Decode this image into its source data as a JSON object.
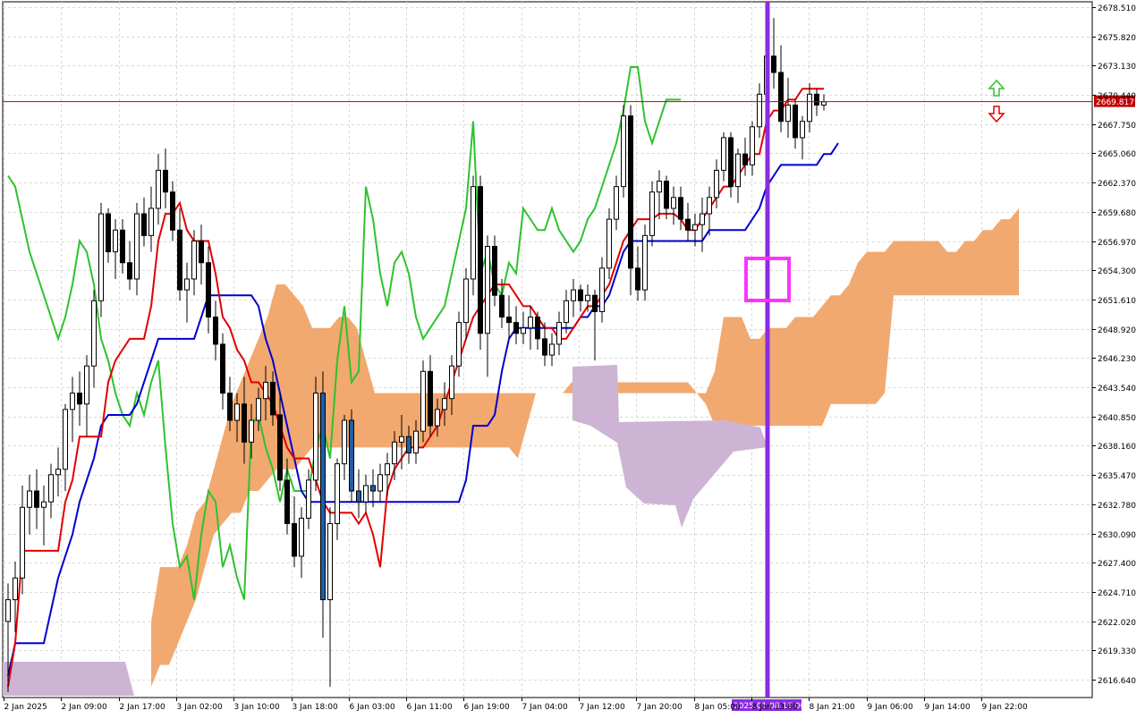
{
  "chart_data": {
    "type": "candlestick",
    "y_axis": {
      "ticks": [
        "2678.510",
        "2675.820",
        "2673.130",
        "2670.440",
        "2667.750",
        "2665.060",
        "2662.370",
        "2659.680",
        "2656.970",
        "2654.300",
        "2651.610",
        "2648.920",
        "2646.230",
        "2643.540",
        "2640.850",
        "2638.160",
        "2635.470",
        "2632.780",
        "2630.090",
        "2627.400",
        "2624.710",
        "2622.020",
        "2619.330",
        "2616.640"
      ],
      "range": [
        2615.0,
        2679.0
      ]
    },
    "x_axis": {
      "ticks": [
        "2 Jan 2025",
        "2 Jan 09:00",
        "2 Jan 17:00",
        "3 Jan 02:00",
        "3 Jan 10:00",
        "3 Jan 18:00",
        "6 Jan 03:00",
        "6 Jan 11:00",
        "6 Jan 19:00",
        "7 Jan 04:00",
        "7 Jan 12:00",
        "7 Jan 20:00",
        "8 Jan 05:00",
        "8 Jan 13:00",
        "8 Jan 21:00",
        "9 Jan 06:00",
        "9 Jan 14:00",
        "9 Jan 22:00"
      ],
      "highlight_label": "2025.01.08 16:00"
    },
    "current_price": "2669.817",
    "grid": true,
    "colors": {
      "tenkan": "#e00000",
      "kijun": "#0000d0",
      "chikou": "#2ec22e",
      "kumo_bull": "#f0a060",
      "kumo_bear": "#cdb4d4",
      "price_line": "#c00000",
      "vertical_marker": "#8b2be2",
      "highlight_box": "#ff33ff",
      "arrow_up": "#2ec22e",
      "arrow_down": "#e00000"
    },
    "candles": [
      {
        "o": 2622.0,
        "h": 2625.5,
        "l": 2615.5,
        "c": 2624.0
      },
      {
        "o": 2624.0,
        "h": 2627.5,
        "l": 2621.0,
        "c": 2626.0
      },
      {
        "o": 2626.0,
        "h": 2634.5,
        "l": 2624.5,
        "c": 2632.5
      },
      {
        "o": 2632.5,
        "h": 2635.5,
        "l": 2630.0,
        "c": 2634.0
      },
      {
        "o": 2634.0,
        "h": 2636.0,
        "l": 2630.5,
        "c": 2632.5
      },
      {
        "o": 2632.5,
        "h": 2634.5,
        "l": 2629.0,
        "c": 2633.0
      },
      {
        "o": 2633.0,
        "h": 2636.5,
        "l": 2631.5,
        "c": 2635.5
      },
      {
        "o": 2635.5,
        "h": 2638.0,
        "l": 2633.5,
        "c": 2636.0
      },
      {
        "o": 2636.0,
        "h": 2642.0,
        "l": 2634.0,
        "c": 2641.5
      },
      {
        "o": 2641.5,
        "h": 2644.5,
        "l": 2638.5,
        "c": 2643.0
      },
      {
        "o": 2643.0,
        "h": 2645.0,
        "l": 2640.0,
        "c": 2642.0
      },
      {
        "o": 2642.0,
        "h": 2646.5,
        "l": 2639.0,
        "c": 2645.5
      },
      {
        "o": 2645.5,
        "h": 2652.5,
        "l": 2643.5,
        "c": 2651.5
      },
      {
        "o": 2651.5,
        "h": 2660.5,
        "l": 2650.0,
        "c": 2659.5
      },
      {
        "o": 2659.5,
        "h": 2660.0,
        "l": 2655.0,
        "c": 2656.0
      },
      {
        "o": 2656.0,
        "h": 2659.0,
        "l": 2653.5,
        "c": 2658.0
      },
      {
        "o": 2658.0,
        "h": 2659.0,
        "l": 2654.0,
        "c": 2655.0
      },
      {
        "o": 2655.0,
        "h": 2657.0,
        "l": 2652.5,
        "c": 2653.5
      },
      {
        "o": 2653.5,
        "h": 2660.5,
        "l": 2652.0,
        "c": 2659.5
      },
      {
        "o": 2659.5,
        "h": 2661.0,
        "l": 2656.5,
        "c": 2657.5
      },
      {
        "o": 2657.5,
        "h": 2662.0,
        "l": 2656.0,
        "c": 2660.0
      },
      {
        "o": 2660.0,
        "h": 2665.0,
        "l": 2658.5,
        "c": 2663.5
      },
      {
        "o": 2663.5,
        "h": 2665.5,
        "l": 2660.0,
        "c": 2661.5
      },
      {
        "o": 2661.5,
        "h": 2662.5,
        "l": 2657.0,
        "c": 2658.0
      },
      {
        "o": 2658.0,
        "h": 2660.0,
        "l": 2651.5,
        "c": 2652.5
      },
      {
        "o": 2652.5,
        "h": 2655.0,
        "l": 2649.5,
        "c": 2653.5
      },
      {
        "o": 2653.5,
        "h": 2658.0,
        "l": 2652.0,
        "c": 2657.0
      },
      {
        "o": 2657.0,
        "h": 2658.5,
        "l": 2653.0,
        "c": 2655.0
      },
      {
        "o": 2655.0,
        "h": 2656.5,
        "l": 2648.5,
        "c": 2650.0
      },
      {
        "o": 2650.0,
        "h": 2651.5,
        "l": 2646.0,
        "c": 2647.5
      },
      {
        "o": 2647.5,
        "h": 2648.5,
        "l": 2641.5,
        "c": 2643.0
      },
      {
        "o": 2643.0,
        "h": 2644.5,
        "l": 2639.5,
        "c": 2640.5
      },
      {
        "o": 2640.5,
        "h": 2643.0,
        "l": 2638.5,
        "c": 2642.0
      },
      {
        "o": 2642.0,
        "h": 2644.5,
        "l": 2636.5,
        "c": 2638.5
      },
      {
        "o": 2638.5,
        "h": 2642.0,
        "l": 2637.0,
        "c": 2640.5
      },
      {
        "o": 2640.5,
        "h": 2643.5,
        "l": 2639.5,
        "c": 2642.5
      },
      {
        "o": 2642.5,
        "h": 2645.5,
        "l": 2640.5,
        "c": 2644.0
      },
      {
        "o": 2644.0,
        "h": 2645.0,
        "l": 2640.0,
        "c": 2641.0
      },
      {
        "o": 2641.0,
        "h": 2643.0,
        "l": 2634.0,
        "c": 2635.0
      },
      {
        "o": 2635.0,
        "h": 2637.0,
        "l": 2630.0,
        "c": 2631.0
      },
      {
        "o": 2631.0,
        "h": 2633.5,
        "l": 2627.0,
        "c": 2628.0
      },
      {
        "o": 2628.0,
        "h": 2632.5,
        "l": 2626.0,
        "c": 2631.5
      },
      {
        "o": 2631.5,
        "h": 2636.0,
        "l": 2630.5,
        "c": 2635.0
      },
      {
        "o": 2635.0,
        "h": 2644.5,
        "l": 2634.0,
        "c": 2643.0
      },
      {
        "o": 2643.0,
        "h": 2645.0,
        "l": 2620.5,
        "c": 2624.0
      },
      {
        "o": 2624.0,
        "h": 2632.5,
        "l": 2616.0,
        "c": 2631.0
      },
      {
        "o": 2631.0,
        "h": 2637.0,
        "l": 2629.5,
        "c": 2636.5
      },
      {
        "o": 2636.5,
        "h": 2641.0,
        "l": 2635.0,
        "c": 2640.5
      },
      {
        "o": 2640.5,
        "h": 2641.5,
        "l": 2633.0,
        "c": 2634.0
      },
      {
        "o": 2634.0,
        "h": 2636.0,
        "l": 2631.5,
        "c": 2633.0
      },
      {
        "o": 2633.0,
        "h": 2635.5,
        "l": 2632.0,
        "c": 2634.5
      },
      {
        "o": 2634.5,
        "h": 2636.0,
        "l": 2632.5,
        "c": 2634.0
      },
      {
        "o": 2634.0,
        "h": 2636.5,
        "l": 2633.0,
        "c": 2635.5
      },
      {
        "o": 2635.5,
        "h": 2637.5,
        "l": 2633.5,
        "c": 2636.5
      },
      {
        "o": 2636.5,
        "h": 2639.5,
        "l": 2635.0,
        "c": 2638.5
      },
      {
        "o": 2638.5,
        "h": 2641.0,
        "l": 2636.0,
        "c": 2639.0
      },
      {
        "o": 2639.0,
        "h": 2640.0,
        "l": 2636.5,
        "c": 2637.5
      },
      {
        "o": 2637.5,
        "h": 2640.5,
        "l": 2636.5,
        "c": 2639.5
      },
      {
        "o": 2639.5,
        "h": 2646.0,
        "l": 2638.5,
        "c": 2645.0
      },
      {
        "o": 2645.0,
        "h": 2646.5,
        "l": 2639.0,
        "c": 2640.0
      },
      {
        "o": 2640.0,
        "h": 2642.5,
        "l": 2639.0,
        "c": 2641.5
      },
      {
        "o": 2641.5,
        "h": 2644.0,
        "l": 2640.0,
        "c": 2642.5
      },
      {
        "o": 2642.5,
        "h": 2646.5,
        "l": 2641.0,
        "c": 2645.5
      },
      {
        "o": 2645.5,
        "h": 2650.5,
        "l": 2644.5,
        "c": 2649.5
      },
      {
        "o": 2649.5,
        "h": 2654.5,
        "l": 2648.0,
        "c": 2653.5
      },
      {
        "o": 2653.5,
        "h": 2663.0,
        "l": 2652.0,
        "c": 2662.0
      },
      {
        "o": 2662.0,
        "h": 2663.0,
        "l": 2647.0,
        "c": 2648.5
      },
      {
        "o": 2648.5,
        "h": 2657.5,
        "l": 2644.5,
        "c": 2656.5
      },
      {
        "o": 2656.5,
        "h": 2657.5,
        "l": 2651.0,
        "c": 2652.0
      },
      {
        "o": 2652.0,
        "h": 2653.5,
        "l": 2649.0,
        "c": 2650.0
      },
      {
        "o": 2650.0,
        "h": 2652.0,
        "l": 2648.0,
        "c": 2649.5
      },
      {
        "o": 2649.5,
        "h": 2651.0,
        "l": 2647.5,
        "c": 2648.5
      },
      {
        "o": 2648.5,
        "h": 2650.5,
        "l": 2647.5,
        "c": 2649.0
      },
      {
        "o": 2649.0,
        "h": 2651.0,
        "l": 2647.0,
        "c": 2650.0
      },
      {
        "o": 2650.0,
        "h": 2650.5,
        "l": 2647.0,
        "c": 2648.0
      },
      {
        "o": 2648.0,
        "h": 2649.5,
        "l": 2645.5,
        "c": 2646.5
      },
      {
        "o": 2646.5,
        "h": 2648.5,
        "l": 2645.5,
        "c": 2647.5
      },
      {
        "o": 2647.5,
        "h": 2650.5,
        "l": 2646.5,
        "c": 2649.5
      },
      {
        "o": 2649.5,
        "h": 2652.5,
        "l": 2648.5,
        "c": 2651.5
      },
      {
        "o": 2651.5,
        "h": 2653.5,
        "l": 2650.0,
        "c": 2652.5
      },
      {
        "o": 2652.5,
        "h": 2653.0,
        "l": 2650.5,
        "c": 2651.5
      },
      {
        "o": 2651.5,
        "h": 2653.0,
        "l": 2650.5,
        "c": 2652.0
      },
      {
        "o": 2652.0,
        "h": 2652.5,
        "l": 2646.0,
        "c": 2650.5
      },
      {
        "o": 2650.5,
        "h": 2655.5,
        "l": 2649.5,
        "c": 2654.5
      },
      {
        "o": 2654.5,
        "h": 2660.0,
        "l": 2653.5,
        "c": 2659.0
      },
      {
        "o": 2659.0,
        "h": 2663.0,
        "l": 2658.0,
        "c": 2662.0
      },
      {
        "o": 2662.0,
        "h": 2669.5,
        "l": 2661.0,
        "c": 2668.5
      },
      {
        "o": 2668.5,
        "h": 2669.5,
        "l": 2652.0,
        "c": 2654.5
      },
      {
        "o": 2654.5,
        "h": 2656.5,
        "l": 2651.5,
        "c": 2652.5
      },
      {
        "o": 2652.5,
        "h": 2658.5,
        "l": 2651.5,
        "c": 2657.5
      },
      {
        "o": 2657.5,
        "h": 2662.5,
        "l": 2656.5,
        "c": 2661.5
      },
      {
        "o": 2661.5,
        "h": 2663.5,
        "l": 2659.0,
        "c": 2662.5
      },
      {
        "o": 2662.5,
        "h": 2663.0,
        "l": 2659.0,
        "c": 2660.0
      },
      {
        "o": 2660.0,
        "h": 2662.0,
        "l": 2658.5,
        "c": 2661.0
      },
      {
        "o": 2661.0,
        "h": 2662.0,
        "l": 2658.0,
        "c": 2659.0
      },
      {
        "o": 2659.0,
        "h": 2660.5,
        "l": 2657.0,
        "c": 2658.0
      },
      {
        "o": 2658.0,
        "h": 2659.5,
        "l": 2656.5,
        "c": 2658.5
      },
      {
        "o": 2658.5,
        "h": 2661.0,
        "l": 2656.0,
        "c": 2659.5
      },
      {
        "o": 2659.5,
        "h": 2662.0,
        "l": 2657.5,
        "c": 2661.0
      },
      {
        "o": 2661.0,
        "h": 2664.5,
        "l": 2660.0,
        "c": 2663.5
      },
      {
        "o": 2663.5,
        "h": 2667.0,
        "l": 2662.5,
        "c": 2666.5
      },
      {
        "o": 2666.5,
        "h": 2667.0,
        "l": 2661.0,
        "c": 2662.0
      },
      {
        "o": 2662.0,
        "h": 2665.5,
        "l": 2660.5,
        "c": 2665.0
      },
      {
        "o": 2665.0,
        "h": 2666.5,
        "l": 2663.0,
        "c": 2664.0
      },
      {
        "o": 2664.0,
        "h": 2668.0,
        "l": 2663.0,
        "c": 2667.5
      },
      {
        "o": 2667.5,
        "h": 2671.5,
        "l": 2666.5,
        "c": 2670.5
      },
      {
        "o": 2670.5,
        "h": 2675.5,
        "l": 2669.5,
        "c": 2674.0
      },
      {
        "o": 2674.0,
        "h": 2677.5,
        "l": 2671.0,
        "c": 2672.5
      },
      {
        "o": 2672.5,
        "h": 2675.0,
        "l": 2667.0,
        "c": 2668.0
      },
      {
        "o": 2668.0,
        "h": 2672.0,
        "l": 2666.5,
        "c": 2669.5
      },
      {
        "o": 2669.5,
        "h": 2670.0,
        "l": 2665.5,
        "c": 2666.5
      },
      {
        "o": 2666.5,
        "h": 2668.5,
        "l": 2664.5,
        "c": 2668.0
      },
      {
        "o": 2668.0,
        "h": 2671.5,
        "l": 2667.0,
        "c": 2670.5
      },
      {
        "o": 2670.5,
        "h": 2671.0,
        "l": 2668.5,
        "c": 2669.5
      },
      {
        "o": 2669.5,
        "h": 2670.5,
        "l": 2669.0,
        "c": 2669.8
      }
    ],
    "tenkan_sen": [
      2616,
      2620,
      2628.5,
      2628.5,
      2628.5,
      2628.5,
      2628.5,
      2628.5,
      2633,
      2635,
      2639,
      2639,
      2639,
      2639,
      2644,
      2646,
      2647,
      2648,
      2648,
      2648,
      2651,
      2657,
      2659.5,
      2659.5,
      2660.5,
      2658,
      2657,
      2657,
      2657,
      2654,
      2650,
      2649,
      2647,
      2646,
      2644,
      2644,
      2643,
      2642,
      2640,
      2638,
      2637,
      2637,
      2637,
      2635,
      2633,
      2632,
      2632,
      2632,
      2632,
      2631,
      2632,
      2630,
      2627,
      2634,
      2636,
      2637,
      2638,
      2638,
      2638,
      2639,
      2640,
      2642,
      2644,
      2646,
      2648,
      2650,
      2651,
      2652,
      2653,
      2653,
      2653,
      2652,
      2651,
      2651,
      2650,
      2649,
      2649,
      2648,
      2648,
      2649,
      2650,
      2651,
      2651,
      2652,
      2653,
      2655,
      2657,
      2658,
      2659,
      2659,
      2659,
      2659.5,
      2659.5,
      2659.5,
      2659,
      2658,
      2658,
      2659,
      2660,
      2661,
      2662,
      2662,
      2663,
      2664,
      2665,
      2665,
      2668,
      2669,
      2669,
      2670,
      2670,
      2671,
      2671,
      2671,
      2671
    ],
    "kijun_sen": [
      2617,
      2620,
      2620,
      2620,
      2620,
      2620,
      2623,
      2626,
      2628,
      2630,
      2633,
      2635,
      2637,
      2640,
      2641,
      2641,
      2641,
      2641,
      2642,
      2644,
      2646,
      2648,
      2648,
      2648,
      2648,
      2648,
      2648,
      2650,
      2652,
      2652,
      2652,
      2652,
      2652,
      2652,
      2652,
      2651,
      2648,
      2646,
      2643,
      2640,
      2637,
      2634,
      2633,
      2633,
      2633,
      2633,
      2633,
      2633,
      2633,
      2633,
      2633,
      2633,
      2633,
      2633,
      2633,
      2633,
      2633,
      2633,
      2633,
      2633,
      2633,
      2633,
      2633,
      2633,
      2635,
      2640,
      2640,
      2640,
      2641,
      2645,
      2648,
      2649,
      2649,
      2649,
      2649,
      2649,
      2649,
      2649,
      2649,
      2649,
      2650,
      2650,
      2651,
      2651,
      2652,
      2654,
      2656,
      2657,
      2657,
      2657,
      2657,
      2657,
      2657,
      2657,
      2657,
      2657,
      2657,
      2657,
      2658,
      2658,
      2658,
      2658,
      2658,
      2658,
      2659,
      2660,
      2662,
      2663,
      2664,
      2664,
      2664,
      2664,
      2664,
      2664,
      2665,
      2665,
      2666
    ],
    "chikou_span": [
      2663,
      2662,
      2659,
      2656,
      2654,
      2652,
      2650,
      2648,
      2650,
      2653,
      2657,
      2656,
      2653,
      2648,
      2646,
      2643,
      2641,
      2640,
      2643,
      2641,
      2644,
      2646,
      2638,
      2631,
      2627,
      2628,
      2624,
      2630,
      2634,
      2633,
      2627,
      2629,
      2626,
      2624,
      2640,
      2641,
      2638,
      2636,
      2633,
      2636,
      2634,
      2634,
      2634,
      2638,
      2640,
      2637,
      2646,
      2651,
      2644,
      2645,
      2662,
      2659,
      2654,
      2651,
      2655,
      2656,
      2654,
      2650,
      2648,
      2649,
      2650,
      2651,
      2654,
      2657,
      2660,
      2668,
      2654,
      2656,
      2653,
      2652,
      2655,
      2654,
      2660,
      2659,
      2658,
      2658,
      2660,
      2658,
      2657,
      2656,
      2657,
      2659,
      2660,
      2662,
      2664,
      2666,
      2669,
      2673,
      2673,
      2668,
      2666,
      2668,
      2670,
      2670,
      2670
    ],
    "kumo_orange_bottom": [
      2616,
      2618,
      2618,
      2620,
      2622,
      2624,
      2627,
      2630,
      2631,
      2632,
      2632,
      2634,
      2634,
      2635,
      2636,
      2636,
      2636,
      2637,
      2638,
      2638,
      2638,
      2638,
      2638,
      2638,
      2638,
      2638,
      2638,
      2638,
      2638,
      2638,
      2638,
      2638,
      2638,
      2638,
      2638,
      2638,
      2638,
      2638,
      2638,
      2638,
      2638,
      2637,
      2640,
      2643,
      2643,
      2643,
      2643,
      2644,
      2644,
      2644,
      2644,
      2644,
      2644,
      2644,
      2644,
      2644,
      2644,
      2644,
      2644,
      2644,
      2644,
      2643,
      2642,
      2640,
      2640,
      2640,
      2640,
      2640,
      2640,
      2640,
      2640,
      2640,
      2640,
      2640,
      2640,
      2640,
      2642,
      2642,
      2642,
      2642,
      2642,
      2642,
      2643,
      2652,
      2652,
      2652,
      2652,
      2652,
      2652,
      2652,
      2652,
      2652,
      2652,
      2652,
      2652,
      2652,
      2652,
      2652
    ],
    "kumo_orange_top": [
      2622,
      2627,
      2627,
      2627,
      2629,
      2632,
      2633,
      2636,
      2639,
      2642,
      2644,
      2646,
      2648,
      2650,
      2653,
      2653,
      2652,
      2651,
      2649,
      2649,
      2649,
      2650,
      2650,
      2649,
      2646,
      2643,
      2643,
      2643,
      2643,
      2643,
      2643,
      2643,
      2643,
      2643,
      2643,
      2643,
      2643,
      2643,
      2643,
      2643,
      2643,
      2643,
      2643,
      2643,
      2643,
      2643,
      2643,
      2643,
      2643,
      2643,
      2643,
      2643,
      2643,
      2643,
      2643,
      2643,
      2643,
      2643,
      2643,
      2643,
      2643,
      2643,
      2643,
      2645,
      2650,
      2650,
      2650,
      2648,
      2648,
      2649,
      2649,
      2649,
      2650,
      2650,
      2650,
      2651,
      2652,
      2652,
      2653,
      2655,
      2656,
      2656,
      2656,
      2657,
      2657,
      2657,
      2657,
      2657,
      2657,
      2656,
      2656,
      2657,
      2657,
      2658,
      2658,
      2659,
      2659,
      2660
    ],
    "labels": {
      "price_tag": "2669.817"
    }
  }
}
